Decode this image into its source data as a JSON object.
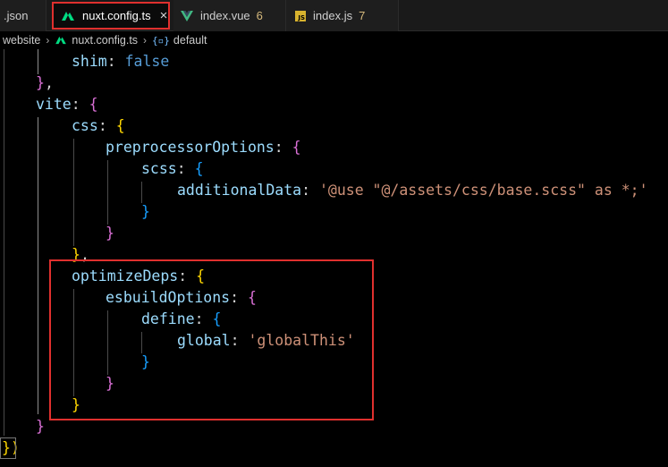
{
  "tabs": [
    {
      "label": ".json",
      "active": false
    },
    {
      "label": "nuxt.config.ts",
      "active": true,
      "close": "×"
    },
    {
      "label": "index.vue",
      "badge": "6",
      "active": false
    },
    {
      "label": "index.js",
      "badge": "7",
      "active": false
    }
  ],
  "breadcrumb": {
    "folder": "website",
    "file": "nuxt.config.ts",
    "symbol": "default"
  },
  "code": {
    "shim_key": "shim",
    "shim_val": "false",
    "vite_key": "vite",
    "css_key": "css",
    "preprocessor_key": "preprocessorOptions",
    "scss_key": "scss",
    "additional_key": "additionalData",
    "additional_val": "'@use \"@/assets/css/base.scss\" as *;'",
    "optimize_key": "optimizeDeps",
    "esbuild_key": "esbuildOptions",
    "define_key": "define",
    "global_key": "global",
    "global_val": "'globalThis'"
  },
  "colors": {
    "highlight_border": "#e0302e",
    "property": "#9cdcfe",
    "string": "#ce9178",
    "keyword": "#569cd6"
  }
}
